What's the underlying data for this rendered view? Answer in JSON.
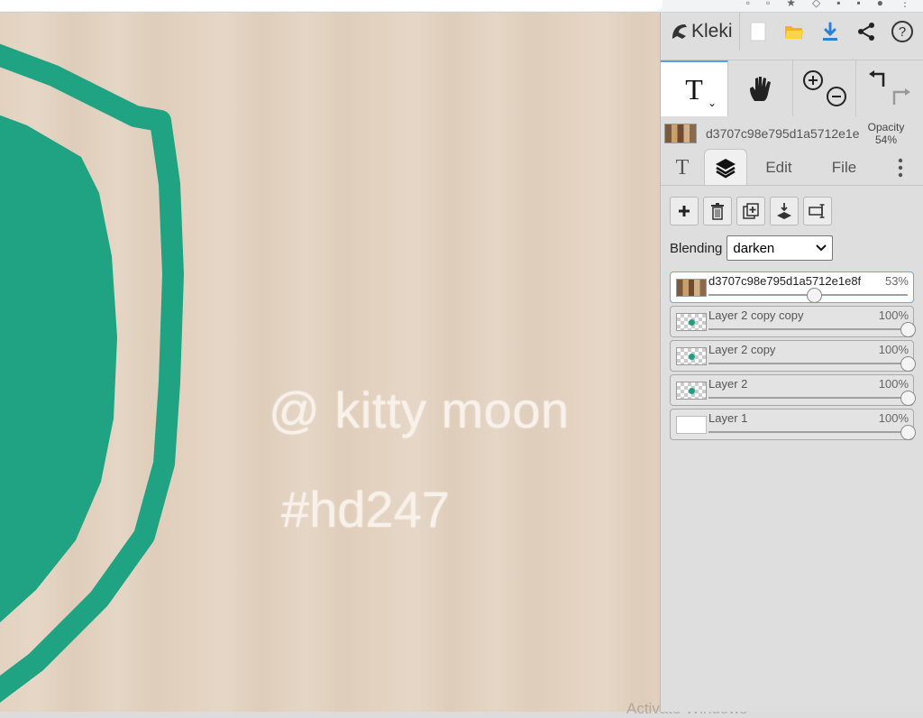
{
  "canvas": {
    "main_text": "@ kitty moon",
    "sub_text": "#hd247",
    "shield_color": "#1fa382",
    "background_color": "#e3d2c0"
  },
  "watermark": "Activate Windows",
  "app": {
    "logo_text": "Kleki",
    "toolbar_icons": [
      "new-image-icon",
      "open-folder-icon",
      "download-icon",
      "share-icon",
      "help-icon"
    ]
  },
  "tools": {
    "active": "text",
    "items": [
      "text-tool",
      "hand-tool",
      "zoom-tool",
      "undo-redo"
    ]
  },
  "layer_info": {
    "name": "d3707c98e795d1a5712e1e",
    "opacity_label": "Opacity",
    "opacity_value": "54%"
  },
  "tabs": {
    "edit": "Edit",
    "file": "File"
  },
  "layer_panel": {
    "blending_label": "Blending",
    "blending_value": "darken",
    "layers": [
      {
        "name": "d3707c98e795d1a5712e1e8f",
        "opacity": "53%",
        "level": 0.53,
        "active": true,
        "thumb": "image"
      },
      {
        "name": "Layer 2 copy copy",
        "opacity": "100%",
        "level": 1.0,
        "active": false,
        "thumb": "checker"
      },
      {
        "name": "Layer 2 copy",
        "opacity": "100%",
        "level": 1.0,
        "active": false,
        "thumb": "checker"
      },
      {
        "name": "Layer 2",
        "opacity": "100%",
        "level": 1.0,
        "active": false,
        "thumb": "checker"
      },
      {
        "name": "Layer 1",
        "opacity": "100%",
        "level": 1.0,
        "active": false,
        "thumb": "white"
      }
    ]
  },
  "accent_color": "#5aa0e8"
}
